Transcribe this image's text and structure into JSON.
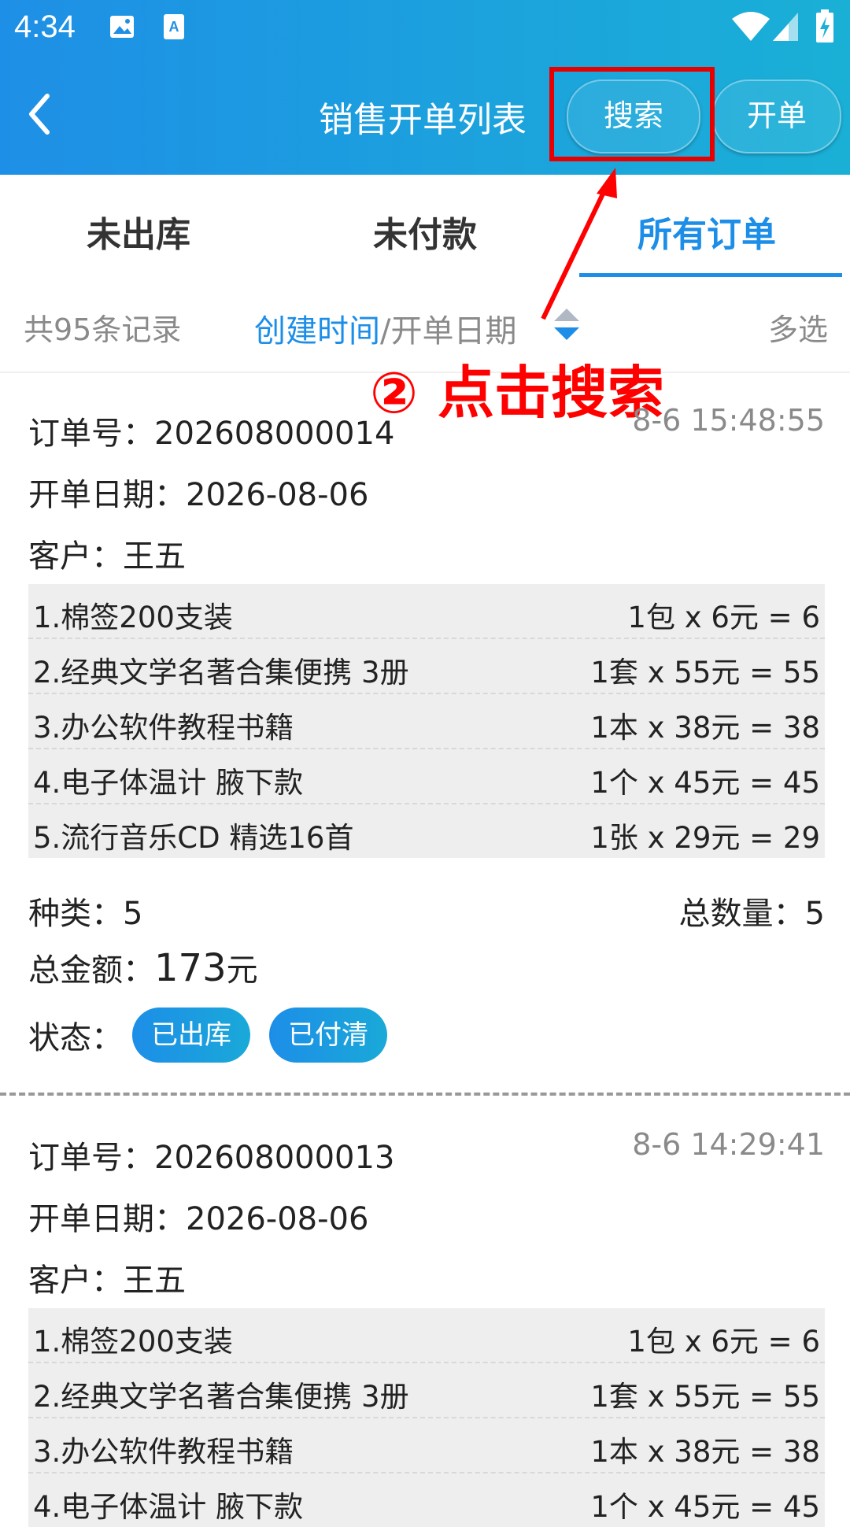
{
  "status": {
    "time": "4:34"
  },
  "header": {
    "title": "销售开单列表",
    "search_label": "搜索",
    "open_label": "开单"
  },
  "tabs": [
    {
      "label": "未出库"
    },
    {
      "label": "未付款"
    },
    {
      "label": "所有订单"
    }
  ],
  "filter": {
    "count": "共95条记录",
    "sort_active": "创建时间",
    "sort_rest": "/开单日期",
    "multi": "多选"
  },
  "annotation": {
    "text": "② 点击搜索"
  },
  "orders": [
    {
      "order_no": "订单号：202608000014",
      "created": "8-6 15:48:55",
      "date": "开单日期：2026-08-06",
      "customer": "客户：王五",
      "items": [
        {
          "name": "1.棉签200支装",
          "price": "1包 x 6元 = 6"
        },
        {
          "name": "2.经典文学名著合集便携 3册",
          "price": "1套 x 55元 = 55"
        },
        {
          "name": "3.办公软件教程书籍",
          "price": "1本 x 38元 = 38"
        },
        {
          "name": "4.电子体温计 腋下款",
          "price": "1个 x 45元 = 45"
        },
        {
          "name": "5.流行音乐CD 精选16首",
          "price": "1张 x 29元 = 29"
        }
      ],
      "kinds": "种类：5",
      "total_qty": "总数量：5",
      "total_label": "总金额：",
      "total_value": "173",
      "total_unit": "元",
      "status_label": "状态：",
      "badges": [
        "已出库",
        "已付清"
      ]
    },
    {
      "order_no": "订单号：202608000013",
      "created": "8-6 14:29:41",
      "date": "开单日期：2026-08-06",
      "customer": "客户：王五",
      "items": [
        {
          "name": "1.棉签200支装",
          "price": "1包 x 6元 = 6"
        },
        {
          "name": "2.经典文学名著合集便携 3册",
          "price": "1套 x 55元 = 55"
        },
        {
          "name": "3.办公软件教程书籍",
          "price": "1本 x 38元 = 38"
        },
        {
          "name": "4.电子体温计 腋下款",
          "price": "1个 x 45元 = 45"
        }
      ]
    }
  ]
}
